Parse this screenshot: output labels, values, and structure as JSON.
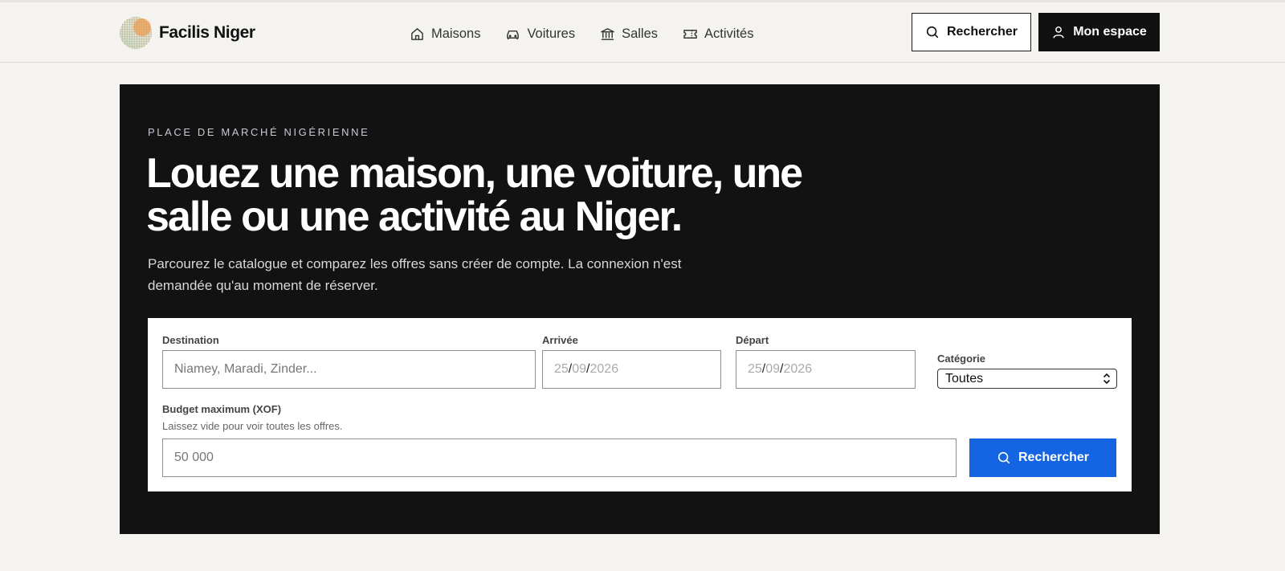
{
  "brand": {
    "name": "Facilis Niger",
    "logo_icon": "gradient-dots-logo"
  },
  "nav": {
    "items": [
      {
        "label": "Maisons",
        "icon": "house-icon"
      },
      {
        "label": "Voitures",
        "icon": "car-icon"
      },
      {
        "label": "Salles",
        "icon": "building-columns-icon"
      },
      {
        "label": "Activités",
        "icon": "ticket-icon"
      }
    ]
  },
  "header_actions": {
    "search_label": "Rechercher",
    "account_label": "Mon espace"
  },
  "hero": {
    "eyebrow": "PLACE DE MARCHÉ NIGÉRIENNE",
    "headline_line1": "Louez une maison, une voiture, une",
    "headline_line2": "salle ou une activité au Niger.",
    "subtitle_line1": "Parcourez le catalogue et comparez les offres sans créer de compte. La connexion n'est",
    "subtitle_line2": "demandée qu'au moment de réserver."
  },
  "search_form": {
    "destination": {
      "label": "Destination",
      "placeholder": "Niamey, Maradi, Zinder..."
    },
    "arrival": {
      "label": "Arrivée",
      "day": "25",
      "month": "09",
      "year": "2026"
    },
    "departure": {
      "label": "Départ",
      "day": "25",
      "month": "09",
      "year": "2026"
    },
    "category": {
      "label": "Catégorie",
      "value": "Toutes"
    },
    "budget": {
      "label": "Budget maximum (XOF)",
      "hint": "Laissez vide pour voir toutes les offres.",
      "placeholder": "50 000"
    },
    "submit_label": "Rechercher"
  },
  "colors": {
    "accent": "#1565e3",
    "hero_bg": "#121212",
    "page_bg": "#f4f3f0"
  }
}
